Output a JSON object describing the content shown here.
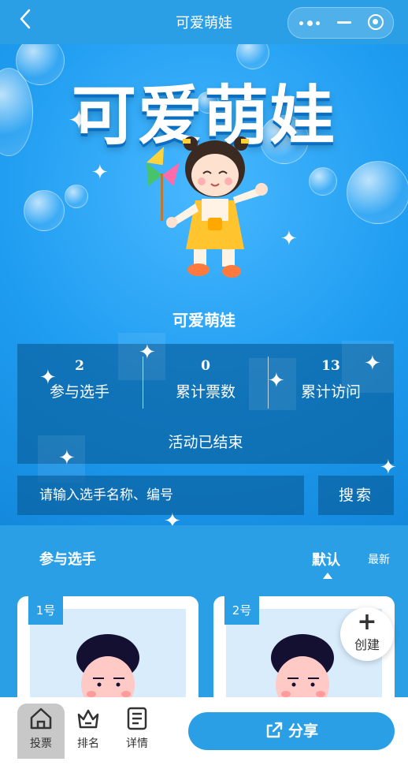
{
  "nav": {
    "title": "可爱萌娃"
  },
  "hero": {
    "big_title": "可爱萌娃",
    "sub_title": "可爱萌娃"
  },
  "stats": [
    {
      "num": "2",
      "label": "参与选手"
    },
    {
      "num": "0",
      "label": "累计票数"
    },
    {
      "num": "13",
      "label": "累计访问"
    }
  ],
  "status": "活动已结束",
  "search": {
    "placeholder": "请输入选手名称、编号",
    "button": "搜索"
  },
  "section": {
    "title": "参与选手",
    "sort_default": "默认",
    "sort_latest": "最新"
  },
  "cards": [
    {
      "number": "1号"
    },
    {
      "number": "2号"
    }
  ],
  "create_label": "创建",
  "tabbar": {
    "vote": "投票",
    "rank": "排名",
    "detail": "详情",
    "share": "分享"
  },
  "colors": {
    "primary": "#2a9fe6",
    "panel": "#0a5a96"
  }
}
